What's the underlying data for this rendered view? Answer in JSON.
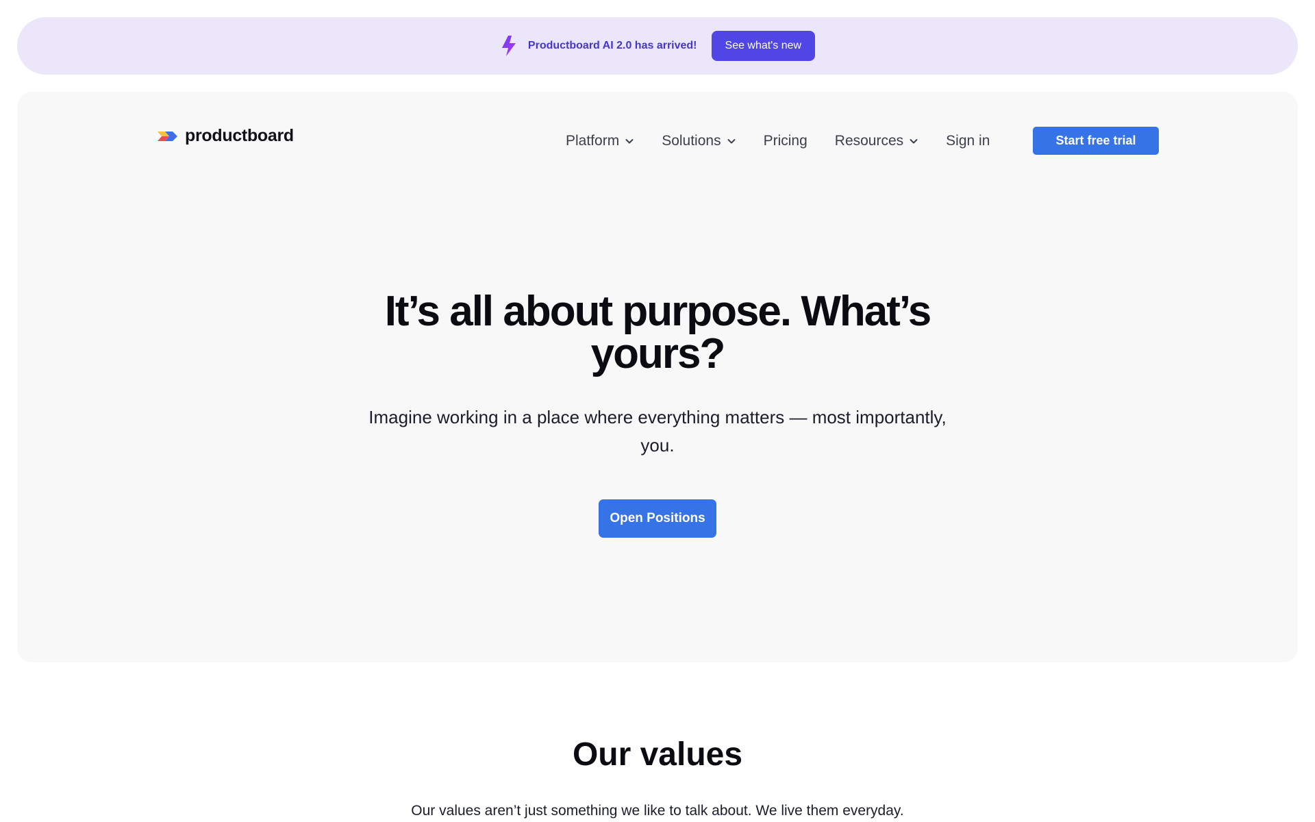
{
  "banner": {
    "icon": "lightning-bolt-icon",
    "text": "Productboard AI 2.0 has arrived!",
    "button_label": "See what's new"
  },
  "header": {
    "logo_text": "productboard",
    "nav": [
      {
        "label": "Platform",
        "has_dropdown": true
      },
      {
        "label": "Solutions",
        "has_dropdown": true
      },
      {
        "label": "Pricing",
        "has_dropdown": false
      },
      {
        "label": "Resources",
        "has_dropdown": true
      },
      {
        "label": "Sign in",
        "has_dropdown": false
      }
    ],
    "cta_label": "Start free trial"
  },
  "hero": {
    "title_line1": "It’s all about purpose. What’s",
    "title_line2": "yours?",
    "subtitle_line1": "Imagine working in a place where everything matters — most importantly,",
    "subtitle_line2": "you.",
    "button_label": "Open Positions"
  },
  "values": {
    "title": "Our values",
    "text": "Our values aren’t just something we like to talk about. We live them everyday."
  },
  "colors": {
    "banner_bg": "#ece6fb",
    "banner_button": "#4f46e5",
    "primary_button": "#3573e6",
    "hero_bg": "#f8f8f9"
  }
}
